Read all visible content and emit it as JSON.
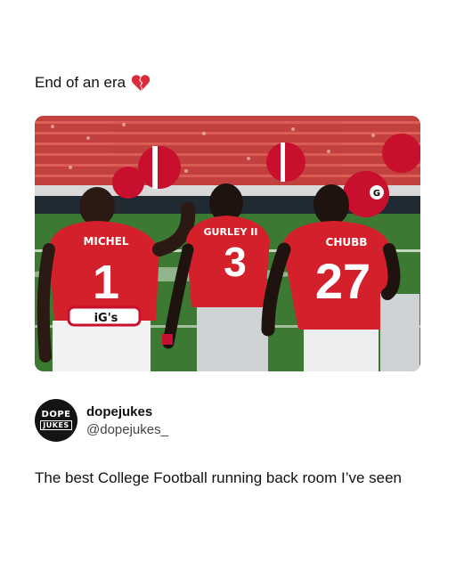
{
  "post": {
    "text": "End of an era",
    "emoji_icon": "broken-heart-icon",
    "image_alt_jerseys": [
      {
        "name": "MICHEL",
        "number": "1"
      },
      {
        "name": "GURLEY II",
        "number": "3"
      },
      {
        "name": "CHUBB",
        "number": "27"
      }
    ],
    "belt_logo": "iG's"
  },
  "author": {
    "avatar_line1": "DOPE",
    "avatar_line2": "JUKES",
    "display_name": "dopejukes",
    "handle": "@dopejukes_"
  },
  "caption": "The best College Football running back room I’ve seen",
  "colors": {
    "jersey_red": "#d4202a",
    "helmet_red": "#c8102e",
    "field_green": "#3c7a34"
  }
}
